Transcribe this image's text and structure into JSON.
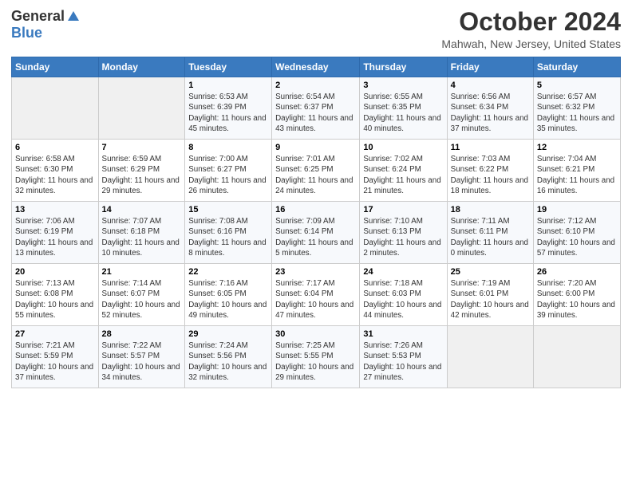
{
  "logo": {
    "general": "General",
    "blue": "Blue"
  },
  "title": "October 2024",
  "subtitle": "Mahwah, New Jersey, United States",
  "days_of_week": [
    "Sunday",
    "Monday",
    "Tuesday",
    "Wednesday",
    "Thursday",
    "Friday",
    "Saturday"
  ],
  "weeks": [
    [
      {
        "num": "",
        "info": ""
      },
      {
        "num": "",
        "info": ""
      },
      {
        "num": "1",
        "info": "Sunrise: 6:53 AM\nSunset: 6:39 PM\nDaylight: 11 hours and 45 minutes."
      },
      {
        "num": "2",
        "info": "Sunrise: 6:54 AM\nSunset: 6:37 PM\nDaylight: 11 hours and 43 minutes."
      },
      {
        "num": "3",
        "info": "Sunrise: 6:55 AM\nSunset: 6:35 PM\nDaylight: 11 hours and 40 minutes."
      },
      {
        "num": "4",
        "info": "Sunrise: 6:56 AM\nSunset: 6:34 PM\nDaylight: 11 hours and 37 minutes."
      },
      {
        "num": "5",
        "info": "Sunrise: 6:57 AM\nSunset: 6:32 PM\nDaylight: 11 hours and 35 minutes."
      }
    ],
    [
      {
        "num": "6",
        "info": "Sunrise: 6:58 AM\nSunset: 6:30 PM\nDaylight: 11 hours and 32 minutes."
      },
      {
        "num": "7",
        "info": "Sunrise: 6:59 AM\nSunset: 6:29 PM\nDaylight: 11 hours and 29 minutes."
      },
      {
        "num": "8",
        "info": "Sunrise: 7:00 AM\nSunset: 6:27 PM\nDaylight: 11 hours and 26 minutes."
      },
      {
        "num": "9",
        "info": "Sunrise: 7:01 AM\nSunset: 6:25 PM\nDaylight: 11 hours and 24 minutes."
      },
      {
        "num": "10",
        "info": "Sunrise: 7:02 AM\nSunset: 6:24 PM\nDaylight: 11 hours and 21 minutes."
      },
      {
        "num": "11",
        "info": "Sunrise: 7:03 AM\nSunset: 6:22 PM\nDaylight: 11 hours and 18 minutes."
      },
      {
        "num": "12",
        "info": "Sunrise: 7:04 AM\nSunset: 6:21 PM\nDaylight: 11 hours and 16 minutes."
      }
    ],
    [
      {
        "num": "13",
        "info": "Sunrise: 7:06 AM\nSunset: 6:19 PM\nDaylight: 11 hours and 13 minutes."
      },
      {
        "num": "14",
        "info": "Sunrise: 7:07 AM\nSunset: 6:18 PM\nDaylight: 11 hours and 10 minutes."
      },
      {
        "num": "15",
        "info": "Sunrise: 7:08 AM\nSunset: 6:16 PM\nDaylight: 11 hours and 8 minutes."
      },
      {
        "num": "16",
        "info": "Sunrise: 7:09 AM\nSunset: 6:14 PM\nDaylight: 11 hours and 5 minutes."
      },
      {
        "num": "17",
        "info": "Sunrise: 7:10 AM\nSunset: 6:13 PM\nDaylight: 11 hours and 2 minutes."
      },
      {
        "num": "18",
        "info": "Sunrise: 7:11 AM\nSunset: 6:11 PM\nDaylight: 11 hours and 0 minutes."
      },
      {
        "num": "19",
        "info": "Sunrise: 7:12 AM\nSunset: 6:10 PM\nDaylight: 10 hours and 57 minutes."
      }
    ],
    [
      {
        "num": "20",
        "info": "Sunrise: 7:13 AM\nSunset: 6:08 PM\nDaylight: 10 hours and 55 minutes."
      },
      {
        "num": "21",
        "info": "Sunrise: 7:14 AM\nSunset: 6:07 PM\nDaylight: 10 hours and 52 minutes."
      },
      {
        "num": "22",
        "info": "Sunrise: 7:16 AM\nSunset: 6:05 PM\nDaylight: 10 hours and 49 minutes."
      },
      {
        "num": "23",
        "info": "Sunrise: 7:17 AM\nSunset: 6:04 PM\nDaylight: 10 hours and 47 minutes."
      },
      {
        "num": "24",
        "info": "Sunrise: 7:18 AM\nSunset: 6:03 PM\nDaylight: 10 hours and 44 minutes."
      },
      {
        "num": "25",
        "info": "Sunrise: 7:19 AM\nSunset: 6:01 PM\nDaylight: 10 hours and 42 minutes."
      },
      {
        "num": "26",
        "info": "Sunrise: 7:20 AM\nSunset: 6:00 PM\nDaylight: 10 hours and 39 minutes."
      }
    ],
    [
      {
        "num": "27",
        "info": "Sunrise: 7:21 AM\nSunset: 5:59 PM\nDaylight: 10 hours and 37 minutes."
      },
      {
        "num": "28",
        "info": "Sunrise: 7:22 AM\nSunset: 5:57 PM\nDaylight: 10 hours and 34 minutes."
      },
      {
        "num": "29",
        "info": "Sunrise: 7:24 AM\nSunset: 5:56 PM\nDaylight: 10 hours and 32 minutes."
      },
      {
        "num": "30",
        "info": "Sunrise: 7:25 AM\nSunset: 5:55 PM\nDaylight: 10 hours and 29 minutes."
      },
      {
        "num": "31",
        "info": "Sunrise: 7:26 AM\nSunset: 5:53 PM\nDaylight: 10 hours and 27 minutes."
      },
      {
        "num": "",
        "info": ""
      },
      {
        "num": "",
        "info": ""
      }
    ]
  ]
}
